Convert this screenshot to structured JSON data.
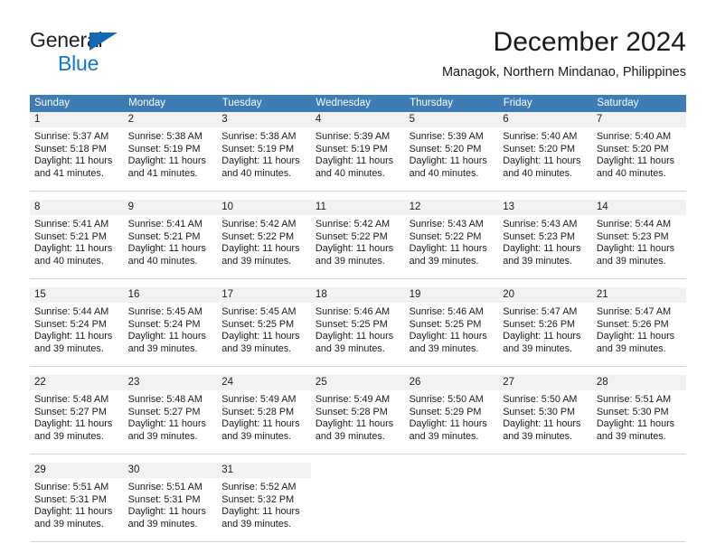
{
  "brand": {
    "name_top": "General",
    "name_bottom": "Blue",
    "color_dark": "#231f20",
    "color_blue": "#1479c9"
  },
  "header": {
    "title": "December 2024",
    "subtitle": "Managok, Northern Mindanao, Philippines"
  },
  "theme": {
    "header_bg": "#3d7cb5",
    "daynum_bg": "#f2f2f2",
    "grid_line": "#d3d3d3",
    "text": "#1a1a1a"
  },
  "calendar": {
    "weekday_headers": [
      "Sunday",
      "Monday",
      "Tuesday",
      "Wednesday",
      "Thursday",
      "Friday",
      "Saturday"
    ],
    "weeks": [
      [
        {
          "day": "1",
          "sunrise": "Sunrise: 5:37 AM",
          "sunset": "Sunset: 5:18 PM",
          "daylight_1": "Daylight: 11 hours",
          "daylight_2": "and 41 minutes."
        },
        {
          "day": "2",
          "sunrise": "Sunrise: 5:38 AM",
          "sunset": "Sunset: 5:19 PM",
          "daylight_1": "Daylight: 11 hours",
          "daylight_2": "and 41 minutes."
        },
        {
          "day": "3",
          "sunrise": "Sunrise: 5:38 AM",
          "sunset": "Sunset: 5:19 PM",
          "daylight_1": "Daylight: 11 hours",
          "daylight_2": "and 40 minutes."
        },
        {
          "day": "4",
          "sunrise": "Sunrise: 5:39 AM",
          "sunset": "Sunset: 5:19 PM",
          "daylight_1": "Daylight: 11 hours",
          "daylight_2": "and 40 minutes."
        },
        {
          "day": "5",
          "sunrise": "Sunrise: 5:39 AM",
          "sunset": "Sunset: 5:20 PM",
          "daylight_1": "Daylight: 11 hours",
          "daylight_2": "and 40 minutes."
        },
        {
          "day": "6",
          "sunrise": "Sunrise: 5:40 AM",
          "sunset": "Sunset: 5:20 PM",
          "daylight_1": "Daylight: 11 hours",
          "daylight_2": "and 40 minutes."
        },
        {
          "day": "7",
          "sunrise": "Sunrise: 5:40 AM",
          "sunset": "Sunset: 5:20 PM",
          "daylight_1": "Daylight: 11 hours",
          "daylight_2": "and 40 minutes."
        }
      ],
      [
        {
          "day": "8",
          "sunrise": "Sunrise: 5:41 AM",
          "sunset": "Sunset: 5:21 PM",
          "daylight_1": "Daylight: 11 hours",
          "daylight_2": "and 40 minutes."
        },
        {
          "day": "9",
          "sunrise": "Sunrise: 5:41 AM",
          "sunset": "Sunset: 5:21 PM",
          "daylight_1": "Daylight: 11 hours",
          "daylight_2": "and 40 minutes."
        },
        {
          "day": "10",
          "sunrise": "Sunrise: 5:42 AM",
          "sunset": "Sunset: 5:22 PM",
          "daylight_1": "Daylight: 11 hours",
          "daylight_2": "and 39 minutes."
        },
        {
          "day": "11",
          "sunrise": "Sunrise: 5:42 AM",
          "sunset": "Sunset: 5:22 PM",
          "daylight_1": "Daylight: 11 hours",
          "daylight_2": "and 39 minutes."
        },
        {
          "day": "12",
          "sunrise": "Sunrise: 5:43 AM",
          "sunset": "Sunset: 5:22 PM",
          "daylight_1": "Daylight: 11 hours",
          "daylight_2": "and 39 minutes."
        },
        {
          "day": "13",
          "sunrise": "Sunrise: 5:43 AM",
          "sunset": "Sunset: 5:23 PM",
          "daylight_1": "Daylight: 11 hours",
          "daylight_2": "and 39 minutes."
        },
        {
          "day": "14",
          "sunrise": "Sunrise: 5:44 AM",
          "sunset": "Sunset: 5:23 PM",
          "daylight_1": "Daylight: 11 hours",
          "daylight_2": "and 39 minutes."
        }
      ],
      [
        {
          "day": "15",
          "sunrise": "Sunrise: 5:44 AM",
          "sunset": "Sunset: 5:24 PM",
          "daylight_1": "Daylight: 11 hours",
          "daylight_2": "and 39 minutes."
        },
        {
          "day": "16",
          "sunrise": "Sunrise: 5:45 AM",
          "sunset": "Sunset: 5:24 PM",
          "daylight_1": "Daylight: 11 hours",
          "daylight_2": "and 39 minutes."
        },
        {
          "day": "17",
          "sunrise": "Sunrise: 5:45 AM",
          "sunset": "Sunset: 5:25 PM",
          "daylight_1": "Daylight: 11 hours",
          "daylight_2": "and 39 minutes."
        },
        {
          "day": "18",
          "sunrise": "Sunrise: 5:46 AM",
          "sunset": "Sunset: 5:25 PM",
          "daylight_1": "Daylight: 11 hours",
          "daylight_2": "and 39 minutes."
        },
        {
          "day": "19",
          "sunrise": "Sunrise: 5:46 AM",
          "sunset": "Sunset: 5:25 PM",
          "daylight_1": "Daylight: 11 hours",
          "daylight_2": "and 39 minutes."
        },
        {
          "day": "20",
          "sunrise": "Sunrise: 5:47 AM",
          "sunset": "Sunset: 5:26 PM",
          "daylight_1": "Daylight: 11 hours",
          "daylight_2": "and 39 minutes."
        },
        {
          "day": "21",
          "sunrise": "Sunrise: 5:47 AM",
          "sunset": "Sunset: 5:26 PM",
          "daylight_1": "Daylight: 11 hours",
          "daylight_2": "and 39 minutes."
        }
      ],
      [
        {
          "day": "22",
          "sunrise": "Sunrise: 5:48 AM",
          "sunset": "Sunset: 5:27 PM",
          "daylight_1": "Daylight: 11 hours",
          "daylight_2": "and 39 minutes."
        },
        {
          "day": "23",
          "sunrise": "Sunrise: 5:48 AM",
          "sunset": "Sunset: 5:27 PM",
          "daylight_1": "Daylight: 11 hours",
          "daylight_2": "and 39 minutes."
        },
        {
          "day": "24",
          "sunrise": "Sunrise: 5:49 AM",
          "sunset": "Sunset: 5:28 PM",
          "daylight_1": "Daylight: 11 hours",
          "daylight_2": "and 39 minutes."
        },
        {
          "day": "25",
          "sunrise": "Sunrise: 5:49 AM",
          "sunset": "Sunset: 5:28 PM",
          "daylight_1": "Daylight: 11 hours",
          "daylight_2": "and 39 minutes."
        },
        {
          "day": "26",
          "sunrise": "Sunrise: 5:50 AM",
          "sunset": "Sunset: 5:29 PM",
          "daylight_1": "Daylight: 11 hours",
          "daylight_2": "and 39 minutes."
        },
        {
          "day": "27",
          "sunrise": "Sunrise: 5:50 AM",
          "sunset": "Sunset: 5:30 PM",
          "daylight_1": "Daylight: 11 hours",
          "daylight_2": "and 39 minutes."
        },
        {
          "day": "28",
          "sunrise": "Sunrise: 5:51 AM",
          "sunset": "Sunset: 5:30 PM",
          "daylight_1": "Daylight: 11 hours",
          "daylight_2": "and 39 minutes."
        }
      ],
      [
        {
          "day": "29",
          "sunrise": "Sunrise: 5:51 AM",
          "sunset": "Sunset: 5:31 PM",
          "daylight_1": "Daylight: 11 hours",
          "daylight_2": "and 39 minutes."
        },
        {
          "day": "30",
          "sunrise": "Sunrise: 5:51 AM",
          "sunset": "Sunset: 5:31 PM",
          "daylight_1": "Daylight: 11 hours",
          "daylight_2": "and 39 minutes."
        },
        {
          "day": "31",
          "sunrise": "Sunrise: 5:52 AM",
          "sunset": "Sunset: 5:32 PM",
          "daylight_1": "Daylight: 11 hours",
          "daylight_2": "and 39 minutes."
        },
        {
          "day": "",
          "sunrise": "",
          "sunset": "",
          "daylight_1": "",
          "daylight_2": ""
        },
        {
          "day": "",
          "sunrise": "",
          "sunset": "",
          "daylight_1": "",
          "daylight_2": ""
        },
        {
          "day": "",
          "sunrise": "",
          "sunset": "",
          "daylight_1": "",
          "daylight_2": ""
        },
        {
          "day": "",
          "sunrise": "",
          "sunset": "",
          "daylight_1": "",
          "daylight_2": ""
        }
      ]
    ]
  }
}
